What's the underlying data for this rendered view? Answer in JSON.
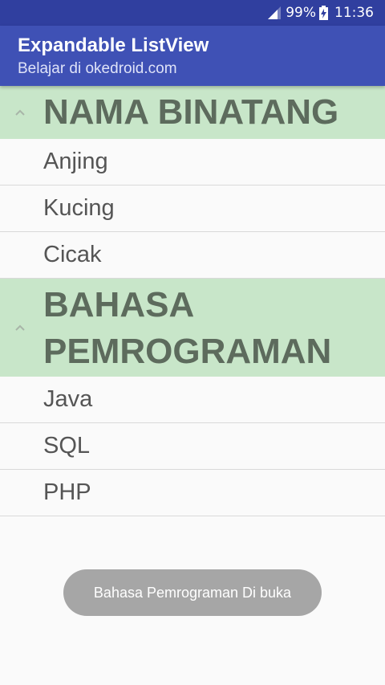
{
  "status_bar": {
    "battery_percent": "99%",
    "time": "11:36",
    "icons": [
      "signal-icon",
      "battery-charging-icon"
    ]
  },
  "app_bar": {
    "title": "Expandable ListView",
    "subtitle": "Belajar di okedroid.com",
    "color": "#3f51b5"
  },
  "groups": [
    {
      "title": "NAMA BINATANG",
      "expanded": true,
      "indicator_icon": "chevron-up-icon",
      "children": [
        "Anjing",
        "Kucing",
        "Cicak"
      ]
    },
    {
      "title": "BAHASA PEMROGRAMAN",
      "expanded": true,
      "indicator_icon": "chevron-up-icon",
      "children": [
        "Java",
        "SQL",
        "PHP"
      ]
    }
  ],
  "group_header_color": "#c8e6c9",
  "toast": {
    "message": "Bahasa Pemrograman Di buka"
  }
}
